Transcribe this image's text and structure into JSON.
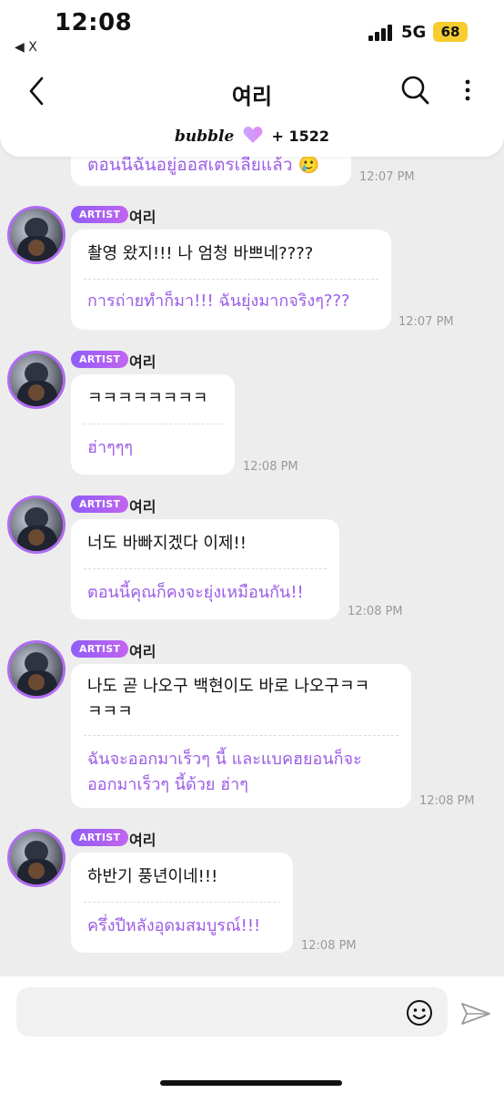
{
  "status_bar": {
    "time": "12:08",
    "back_app": "◀ X",
    "network": "5G",
    "battery": "68"
  },
  "header": {
    "title": "여리",
    "bubble_word": "bubble",
    "subscriber_count": "+ 1522"
  },
  "messages_top_cut": {
    "thai": "ตอนนี้ฉันอยู่ออสเตรเลียแล้ว 🥲",
    "time": "12:07 PM"
  },
  "sender": {
    "badge": "ARTIST",
    "name": "여리"
  },
  "messages": [
    {
      "korean": "촬영 왔지!!! 나 엄청 바쁘네????",
      "thai": "การถ่ายทำก็มา!!! ฉันยุ่งมากจริงๆ???",
      "time": "12:07 PM"
    },
    {
      "korean": "ㅋㅋㅋㅋㅋㅋㅋㅋ",
      "thai": "ฮ่าๆๆๆ",
      "time": "12:08 PM"
    },
    {
      "korean": "너도 바빠지겠다 이제!!",
      "thai": "ตอนนี้คุณก็คงจะยุ่งเหมือนกัน!!",
      "time": "12:08 PM"
    },
    {
      "korean_line1": "나도 곧 나오구 백현이도 바로 나오구ㅋㅋ",
      "korean_line2": "ㅋㅋㅋ",
      "thai_line1": "ฉันจะออกมาเร็วๆ นี้ และแบคฮยอนก็จะ",
      "thai_line2": "ออกมาเร็วๆ นี้ด้วย ฮ่าๆ",
      "time": "12:08 PM"
    },
    {
      "korean": "하반기 풍년이네!!!",
      "thai": "ครึ่งปีหลังอุดมสมบูรณ์!!!",
      "time": "12:08 PM"
    }
  ],
  "input": {
    "placeholder": ""
  },
  "colors": {
    "accent": "#9b5de5",
    "badge_start": "#8f5df7",
    "badge_end": "#c264f0",
    "battery": "#f6cc2f"
  },
  "icons": [
    "back-arrow-icon",
    "search-icon",
    "more-vertical-icon",
    "heart-icon",
    "emoji-icon",
    "send-icon"
  ]
}
